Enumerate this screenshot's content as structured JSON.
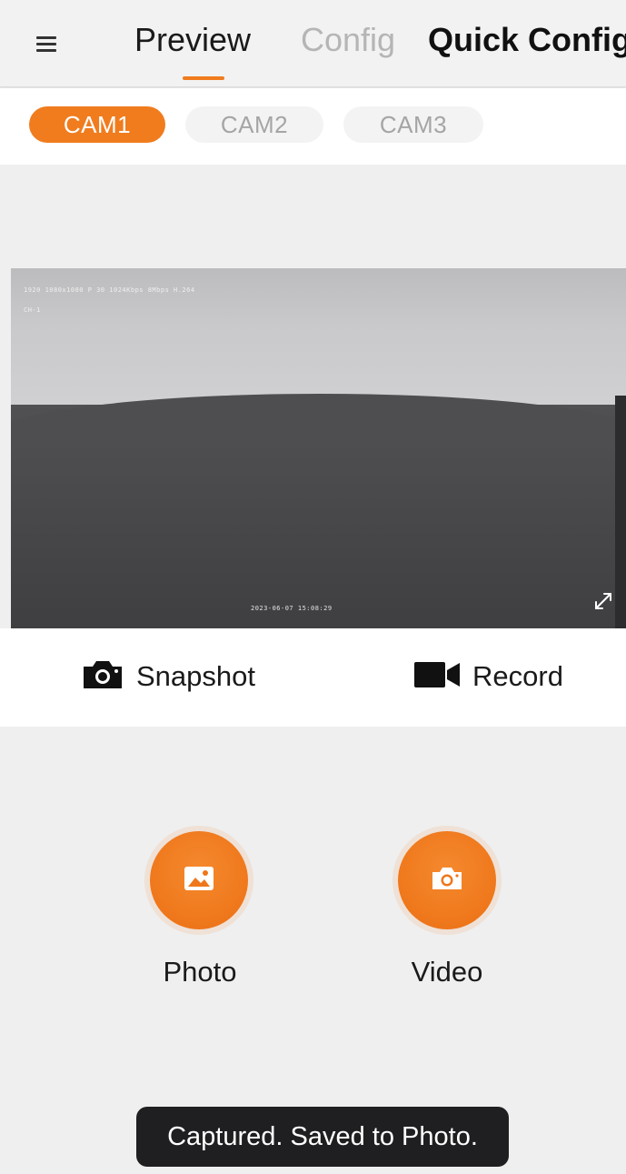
{
  "header": {
    "tabs": [
      {
        "label": "Preview",
        "active": true
      },
      {
        "label": "Config",
        "active": false
      },
      {
        "label": "Quick Config",
        "active": false
      }
    ],
    "menu_icon": "hamburger-menu-icon"
  },
  "cameras": {
    "items": [
      {
        "label": "CAM1",
        "active": true
      },
      {
        "label": "CAM2",
        "active": false
      },
      {
        "label": "CAM3",
        "active": false
      }
    ]
  },
  "video": {
    "osd_line1": "1920 1080x1080 P 30 1024Kbps  8Mbps  H.264",
    "osd_line2": "CH-1",
    "osd_timestamp": "2023-06-07 15:08:29",
    "expand_icon": "expand-icon"
  },
  "actions": {
    "snapshot": {
      "label": "Snapshot",
      "icon": "camera-icon"
    },
    "record": {
      "label": "Record",
      "icon": "video-camera-icon"
    }
  },
  "gallery": {
    "photo": {
      "label": "Photo",
      "icon": "image-icon"
    },
    "video": {
      "label": "Video",
      "icon": "camera-icon"
    }
  },
  "toast": {
    "message": "Captured. Saved to Photo."
  },
  "colors": {
    "accent": "#f07c1e",
    "toast_bg": "#1f1f21",
    "inactive_tab": "#b5b5b5"
  }
}
